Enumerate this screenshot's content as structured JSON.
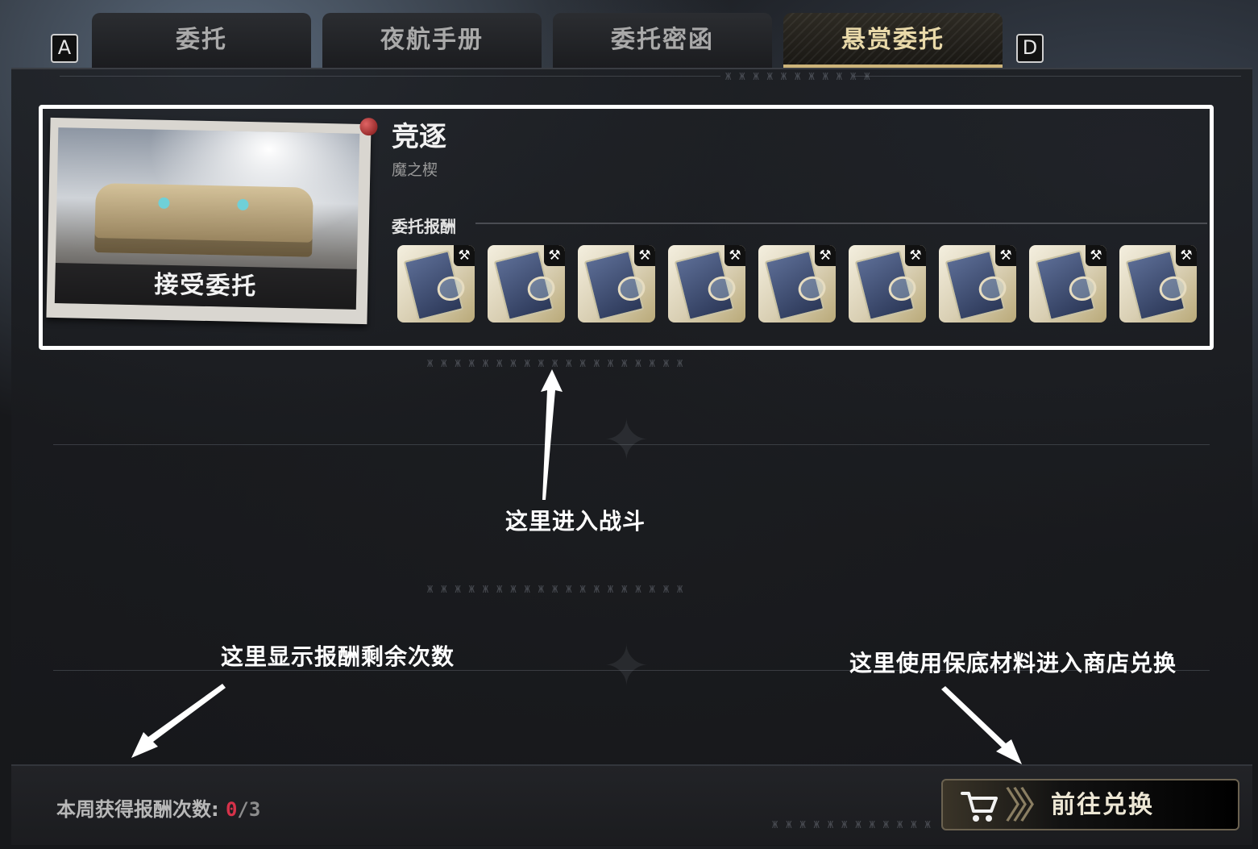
{
  "tabs": {
    "left_key": "A",
    "right_key": "D",
    "items": [
      {
        "label": "委托"
      },
      {
        "label": "夜航手册"
      },
      {
        "label": "委托密函"
      },
      {
        "label": "悬赏委托"
      }
    ],
    "active_index": 3
  },
  "bounty": {
    "title": "竞逐",
    "subtitle": "魔之楔",
    "accept_label": "接受委托",
    "reward_label": "委托报酬",
    "rewards": [
      {
        "icon": "manual-book-icon",
        "badge": "hammer-icon"
      },
      {
        "icon": "manual-book-icon",
        "badge": "hammer-icon"
      },
      {
        "icon": "manual-book-icon",
        "badge": "hammer-icon"
      },
      {
        "icon": "manual-book-icon",
        "badge": "hammer-icon"
      },
      {
        "icon": "manual-book-icon",
        "badge": "hammer-icon"
      },
      {
        "icon": "manual-book-icon",
        "badge": "hammer-icon"
      },
      {
        "icon": "manual-book-icon",
        "badge": "hammer-icon"
      },
      {
        "icon": "manual-book-icon",
        "badge": "hammer-icon"
      },
      {
        "icon": "manual-book-icon",
        "badge": "hammer-icon"
      }
    ]
  },
  "annotations": {
    "battle": "这里进入战斗",
    "remaining": "这里显示报酬剩余次数",
    "shop": "这里使用保底材料进入商店兑换"
  },
  "footer": {
    "weekly_label": "本周获得报酬次数:",
    "weekly_count": "0",
    "weekly_max": "/3",
    "exchange_label": "前往兑换"
  },
  "colors": {
    "accent_gold": "#cdb47a",
    "count_red": "#d6324a",
    "highlight": "#ffffff"
  }
}
